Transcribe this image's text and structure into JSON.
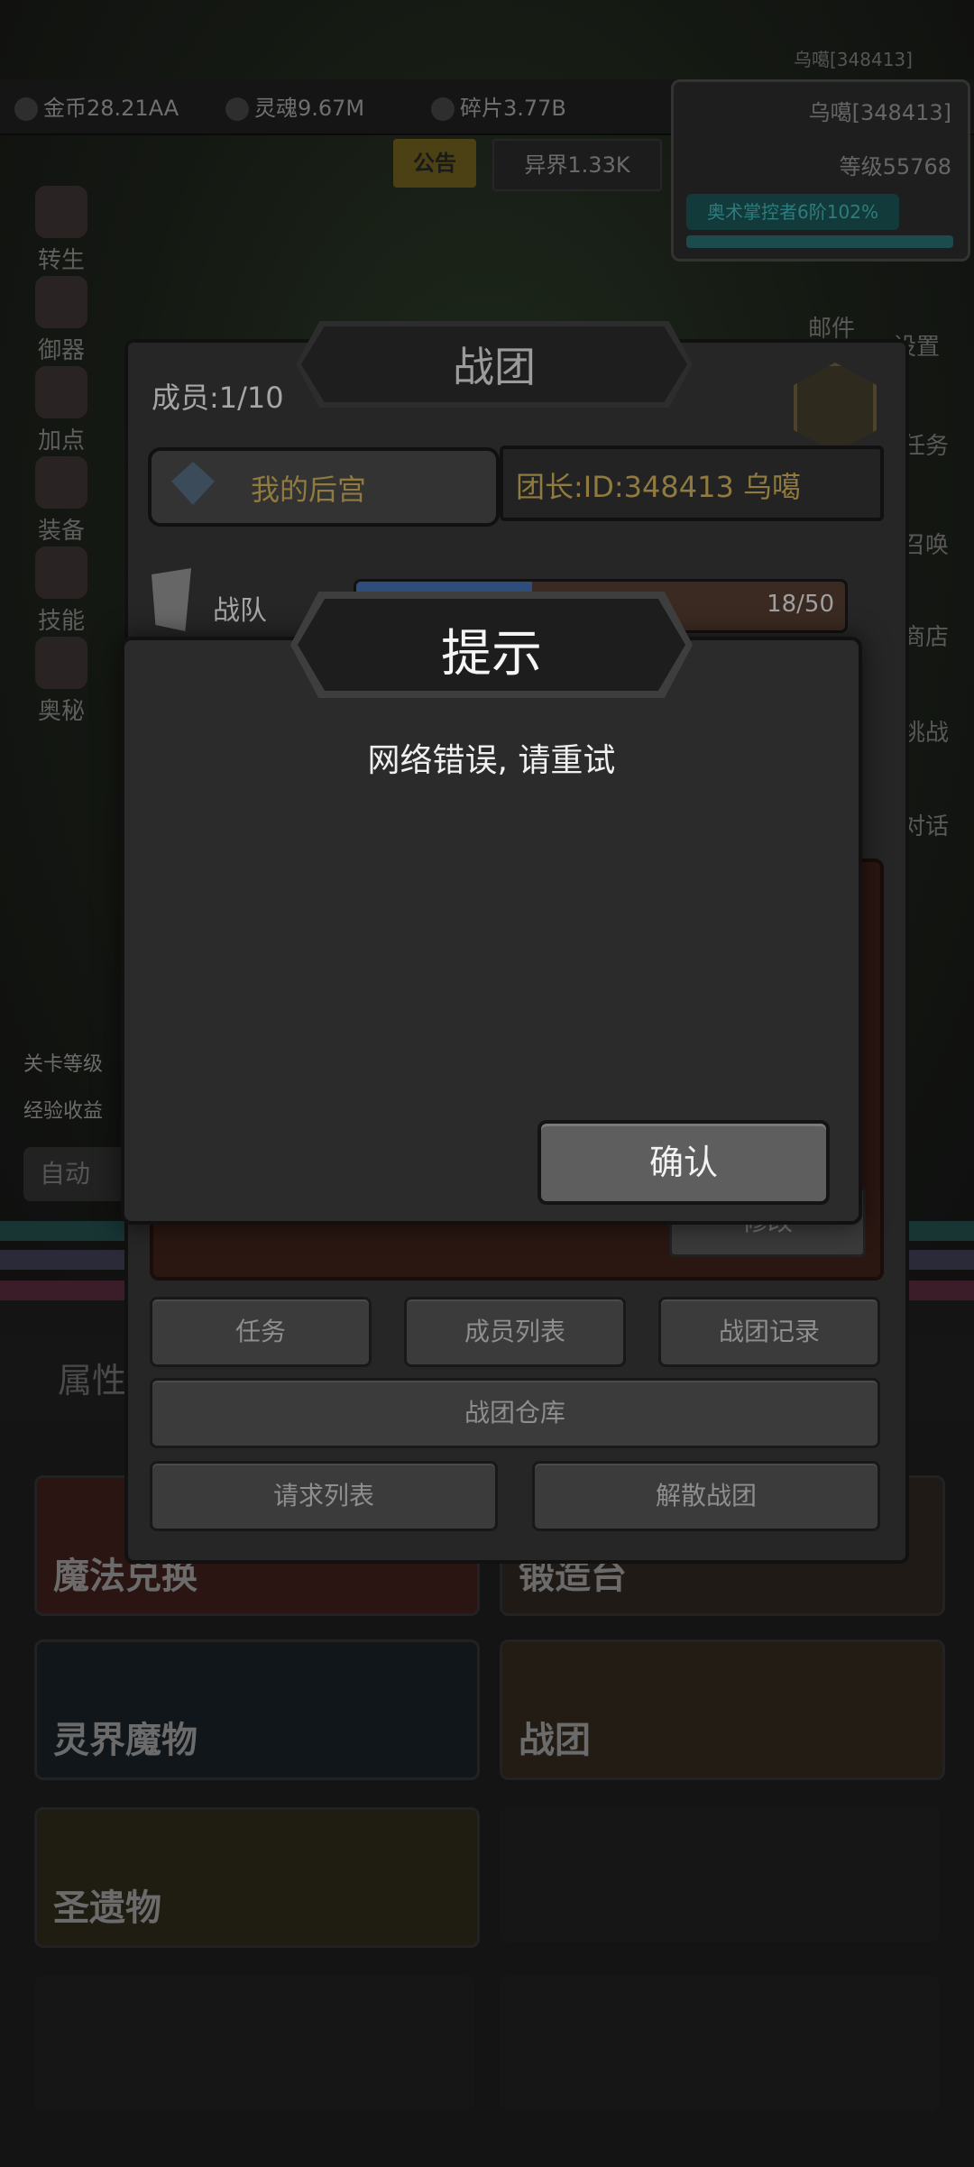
{
  "status_bar": {
    "username": "乌噶[348413]"
  },
  "resources": {
    "gold": "金币28.21AA",
    "soul": "灵魂9.67M",
    "fragments": "碎片3.77B"
  },
  "player": {
    "name": "乌噶[348413]",
    "level": "等级55768",
    "mastery": "奥术掌控者6阶102%"
  },
  "top_tabs": {
    "notice": "公告",
    "otherworld": "异界1.33K"
  },
  "side_menu": [
    "转生",
    "御器",
    "加点",
    "装备",
    "技能",
    "奥秘"
  ],
  "right_menu": [
    "邮件",
    "设置",
    "任务",
    "召唤",
    "商店",
    "挑战",
    "对话"
  ],
  "stage": {
    "level_label": "关卡等级",
    "exp_label": "经验收益",
    "auto_button": "自动"
  },
  "attribute_tab": "属性",
  "grid_tiles": [
    "魔法兑换",
    "锻造台",
    "灵界魔物",
    "战团",
    "圣遗物"
  ],
  "legion": {
    "title": "战团",
    "members": "成员:1/10",
    "my_group_button": "我的后宫",
    "leader": "团长:ID:348413 乌噶",
    "team_label": "战队",
    "team_progress_text": "18/50",
    "team_progress": 0.36,
    "modify_button": "修改",
    "buttons": {
      "tasks": "任务",
      "member_list": "成员列表",
      "legion_log": "战团记录",
      "warehouse": "战团仓库",
      "request_list": "请求列表",
      "disband": "解散战团"
    }
  },
  "dialog": {
    "title": "提示",
    "message": "网络错误, 请重试",
    "confirm_button": "确认"
  },
  "colors": {
    "gold_text": "#8f7a3f",
    "progress_blue": "#2f4d7a",
    "teal": "#1b4b4d"
  }
}
